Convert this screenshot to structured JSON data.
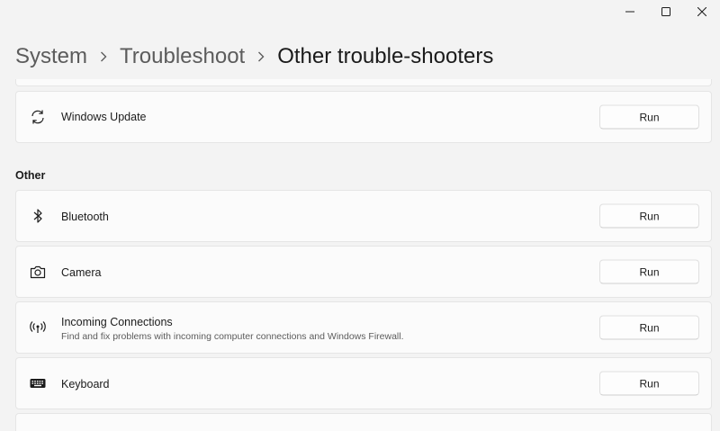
{
  "window": {
    "minimize_icon": "minimize-icon",
    "maximize_icon": "maximize-icon",
    "close_icon": "close-icon"
  },
  "breadcrumb": {
    "items": [
      "System",
      "Troubleshoot"
    ],
    "current": "Other trouble-shooters",
    "separator_icon": "chevron-right-icon"
  },
  "top_items": [
    {
      "icon": "refresh-icon",
      "label": "Windows Update",
      "button": "Run"
    }
  ],
  "other_section": {
    "header": "Other",
    "items": [
      {
        "icon": "bluetooth-icon",
        "label": "Bluetooth",
        "button": "Run"
      },
      {
        "icon": "camera-icon",
        "label": "Camera",
        "button": "Run"
      },
      {
        "icon": "antenna-icon",
        "label": "Incoming Connections",
        "description": "Find and fix problems with incoming computer connections and Windows Firewall.",
        "button": "Run"
      },
      {
        "icon": "keyboard-icon",
        "label": "Keyboard",
        "button": "Run"
      }
    ]
  },
  "colors": {
    "background": "#f3f3f3",
    "card": "#fbfbfb",
    "border": "#e5e5e5",
    "text": "#1b1b1b",
    "secondary_text": "#5c5c5c"
  }
}
